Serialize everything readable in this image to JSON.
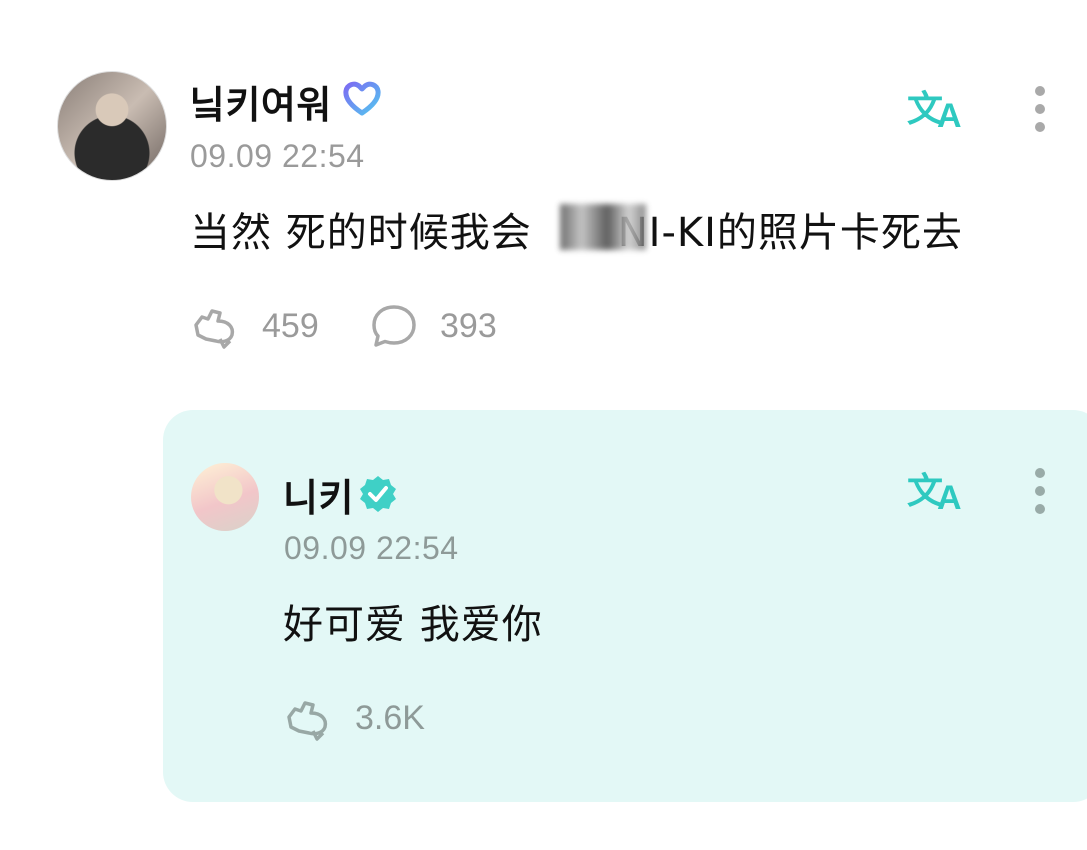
{
  "post": {
    "author": "닠키여워",
    "timestamp": "09.09 22:54",
    "text_before": "当然 死的时候我会",
    "text_after": "NI-KI的照片卡死去",
    "likes": "459",
    "comments": "393"
  },
  "reply": {
    "author": "니키",
    "timestamp": "09.09 22:54",
    "text": "好可爱 我爱你",
    "likes": "3.6K"
  },
  "icons": {
    "translate": "translate-icon",
    "more": "more-vertical-icon",
    "like": "like-icon",
    "comment": "comment-icon",
    "verified": "verified-badge-icon",
    "fan_badge": "fan-badge-icon"
  },
  "colors": {
    "accent": "#2ec9c0",
    "reply_background": "#e3f8f6",
    "muted_text": "#9a9a9a"
  }
}
